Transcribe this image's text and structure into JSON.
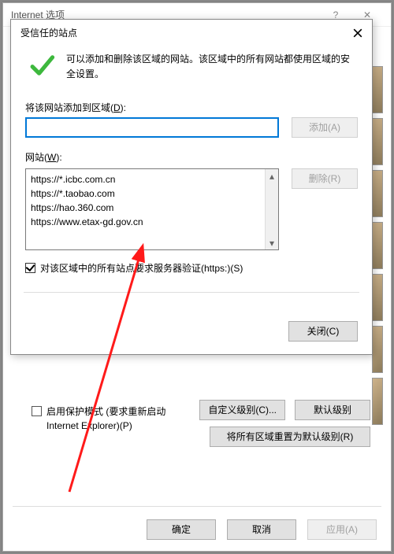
{
  "outer": {
    "title": "Internet 选项",
    "protect_mode": "启用保护模式 (要求重新启动 Internet Explorer)(P)",
    "custom_level": "自定义级别(C)...",
    "default_level": "默认级别",
    "reset_all": "将所有区域重置为默认级别(R)",
    "ok": "确定",
    "cancel": "取消",
    "apply": "应用(A)"
  },
  "modal": {
    "title": "受信任的站点",
    "info": "可以添加和删除该区域的网站。该区域中的所有网站都使用区域的安全设置。",
    "add_label_pre": "将该网站添加到区域(",
    "add_label_ul": "D",
    "add_label_post": "):",
    "input_value": "",
    "add_btn": "添加(A)",
    "list_label_pre": "网站(",
    "list_label_ul": "W",
    "list_label_post": "):",
    "remove_btn": "删除(R)",
    "sites": [
      "https://*.icbc.com.cn",
      "https://*.taobao.com",
      "https://hao.360.com",
      "https://www.etax-gd.gov.cn"
    ],
    "require_pre": "对该区域中的所有站点要求服务器验证(https:)(",
    "require_ul": "S",
    "require_post": ")",
    "close_btn": "关闭(C)"
  }
}
